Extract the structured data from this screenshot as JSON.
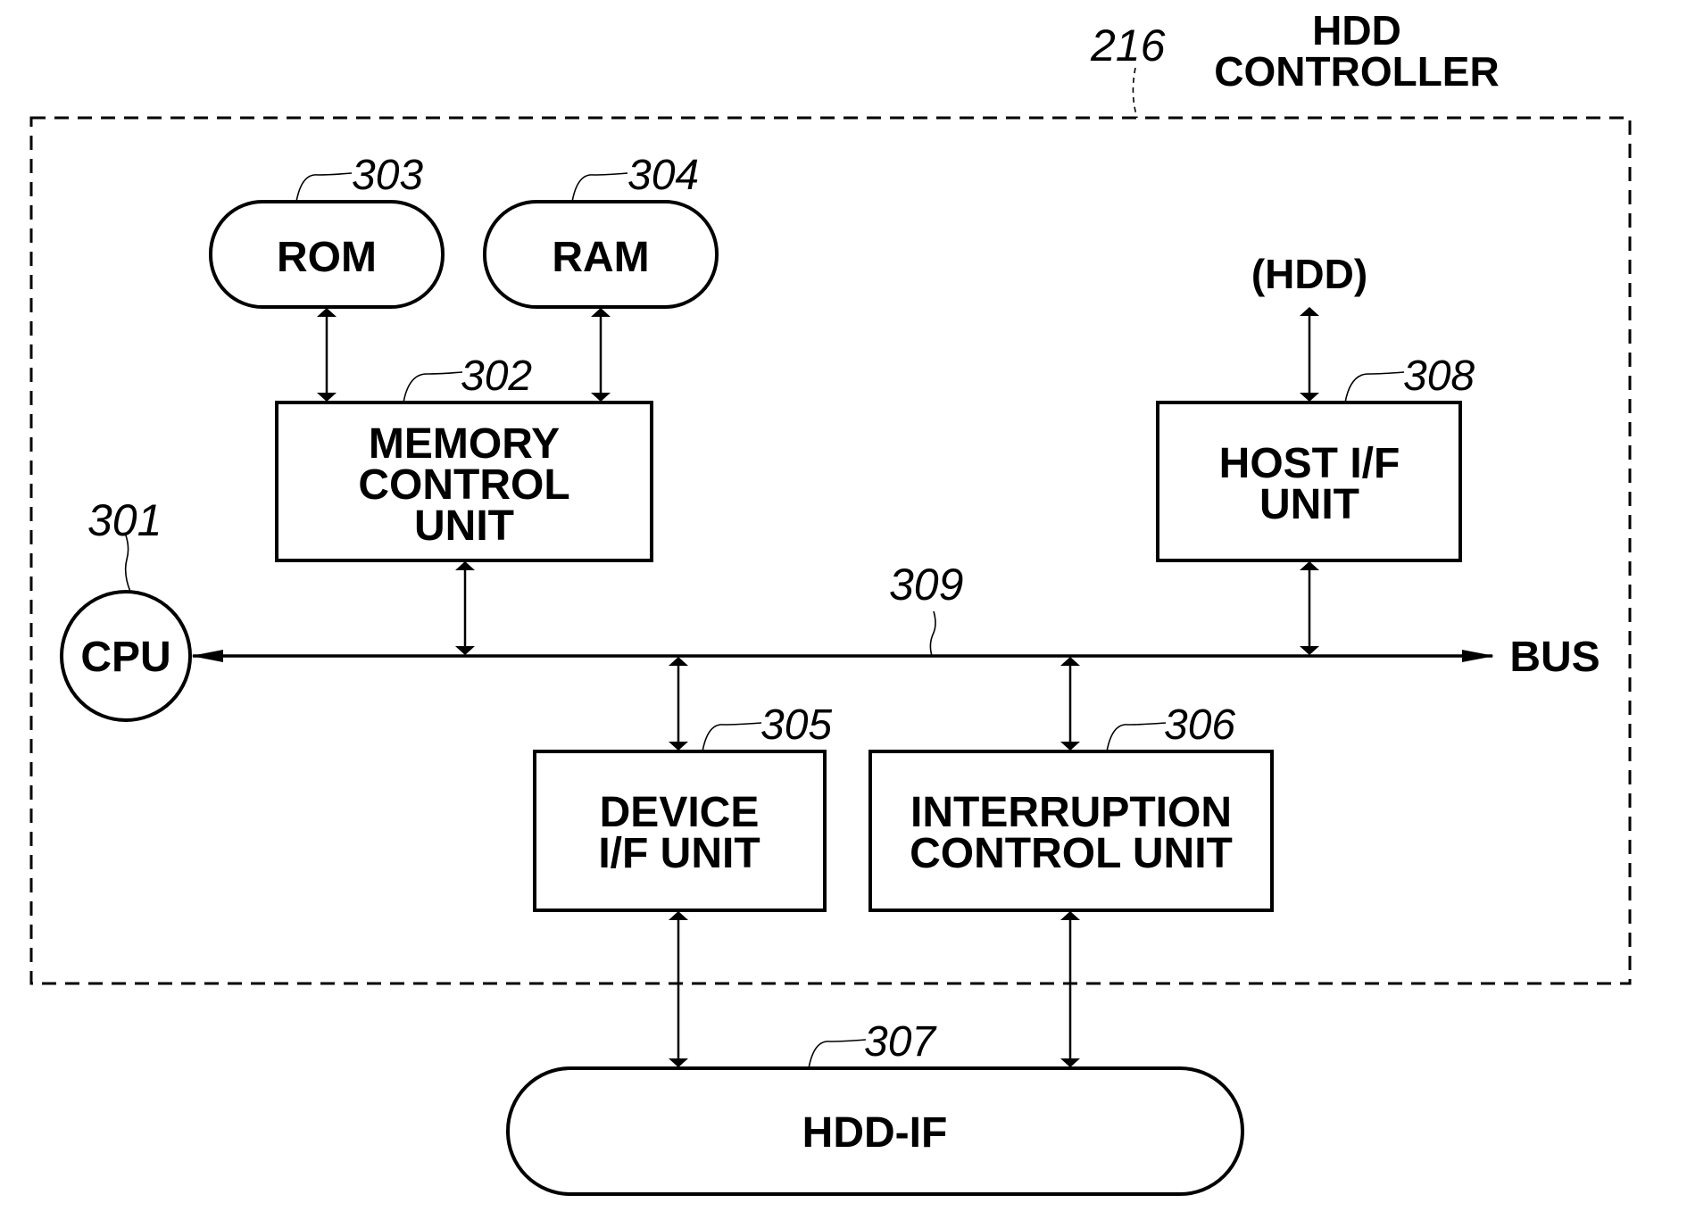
{
  "title": {
    "ref": "216",
    "line1": "HDD",
    "line2": "CONTROLLER"
  },
  "components": {
    "cpu": {
      "ref": "301",
      "label": "CPU"
    },
    "memory_control": {
      "ref": "302",
      "lines": [
        "MEMORY",
        "CONTROL",
        "UNIT"
      ]
    },
    "rom": {
      "ref": "303",
      "label": "ROM"
    },
    "ram": {
      "ref": "304",
      "label": "RAM"
    },
    "device_if": {
      "ref": "305",
      "lines": [
        "DEVICE",
        "I/F UNIT"
      ]
    },
    "interruption_control": {
      "ref": "306",
      "lines": [
        "INTERRUPTION",
        "CONTROL UNIT"
      ]
    },
    "hdd_if": {
      "ref": "307",
      "label": "HDD-IF"
    },
    "host_if": {
      "ref": "308",
      "lines": [
        "HOST I/F",
        "UNIT"
      ]
    },
    "bus": {
      "ref": "309",
      "label": "BUS"
    }
  },
  "external": {
    "hdd_label": "(HDD)"
  },
  "connections": [
    {
      "from": "rom",
      "to": "memory_control",
      "type": "bidirectional"
    },
    {
      "from": "ram",
      "to": "memory_control",
      "type": "bidirectional"
    },
    {
      "from": "memory_control",
      "to": "bus",
      "type": "bidirectional"
    },
    {
      "from": "hdd",
      "to": "host_if",
      "type": "bidirectional"
    },
    {
      "from": "host_if",
      "to": "bus",
      "type": "bidirectional"
    },
    {
      "from": "bus",
      "to": "cpu",
      "type": "arrow"
    },
    {
      "from": "bus",
      "to": "device_if",
      "type": "bidirectional"
    },
    {
      "from": "bus",
      "to": "interruption_control",
      "type": "bidirectional"
    },
    {
      "from": "device_if",
      "to": "hdd_if",
      "type": "bidirectional"
    },
    {
      "from": "interruption_control",
      "to": "hdd_if",
      "type": "bidirectional"
    }
  ]
}
